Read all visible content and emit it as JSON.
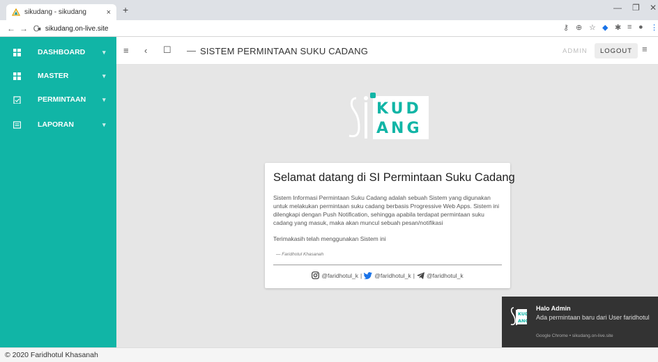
{
  "browser": {
    "tab_title": "sikudang - sikudang",
    "tab_close": "×",
    "new_tab": "+",
    "url": "sikudang.on-live.site"
  },
  "sidebar": {
    "items": [
      {
        "label": "DASHBOARD",
        "icon": "dashboard-icon"
      },
      {
        "label": "MASTER",
        "icon": "grid-icon"
      },
      {
        "label": "PERMINTAAN",
        "icon": "clipboard-check-icon"
      },
      {
        "label": "LAPORAN",
        "icon": "report-icon"
      }
    ]
  },
  "header": {
    "title": "SISTEM PERMINTAAN SUKU CADANG",
    "user": "ADMIN",
    "logout": "LOGOUT"
  },
  "logo": {
    "line1": "KUD",
    "line2": "ANG"
  },
  "card": {
    "title": "Selamat datang di SI Permintaan Suku Cadang",
    "body": "Sistem Informasi Permintaan Suku Cadang adalah sebuah Sistem yang digunakan untuk melakukan permintaan suku cadang berbasis Progressive Web Apps. Sistem ini dilengkapi dengan Push Notification, sehingga apabila terdapat permintaan suku cadang yang masuk, maka akan muncul sebuah pesan/notifikasi",
    "thanks": "Terimakasih telah menggunakan Sistem ini",
    "signature": "— Faridhotul Khasanah",
    "social": {
      "instagram": "@faridhotul_k",
      "twitter": "@faridhotul_k",
      "telegram": "@faridhotul_k",
      "separator": "|"
    }
  },
  "notification": {
    "title": "Halo Admin",
    "message": "Ada permintaan baru dari User faridhotul",
    "source": "Google Chrome • sikudang.on-live.site"
  },
  "footer": {
    "text": "© 2020 Faridhotul Khasanah"
  },
  "colors": {
    "accent": "#11b5a6",
    "notification_bg": "#333333",
    "background": "#e6e6e6"
  }
}
